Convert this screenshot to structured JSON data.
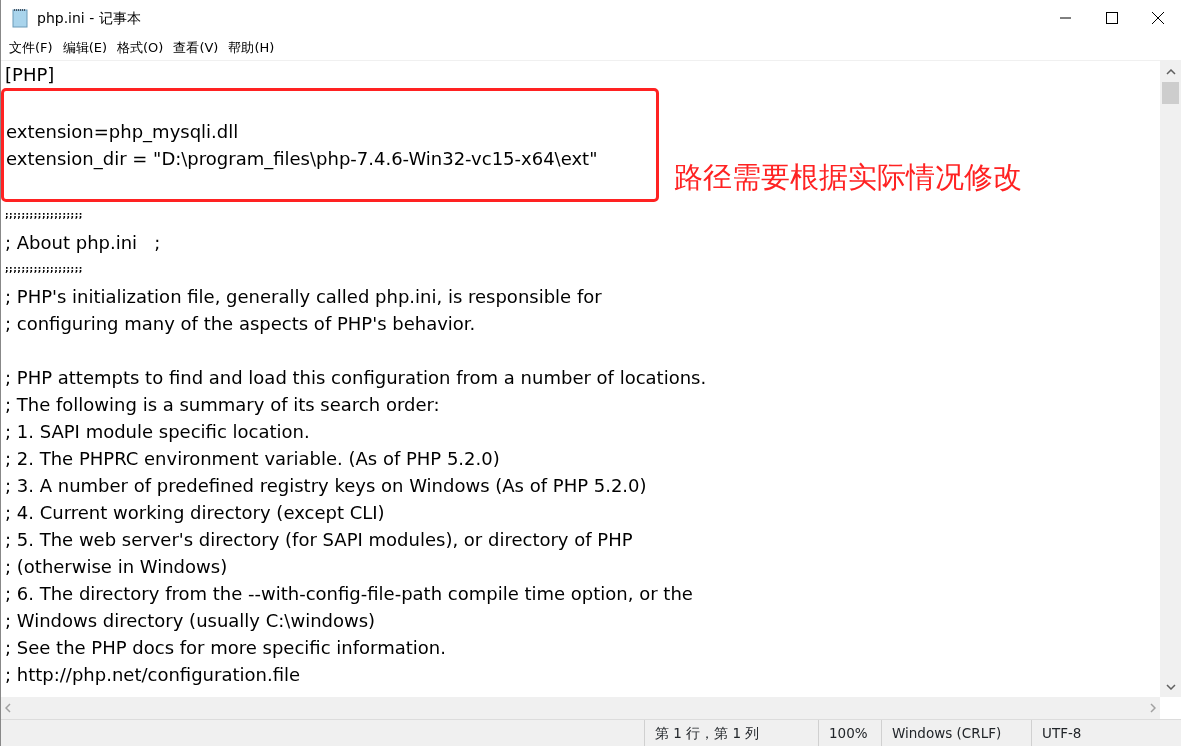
{
  "window": {
    "title": "php.ini - 记事本"
  },
  "menu": [
    "文件(F)",
    "编辑(E)",
    "格式(O)",
    "查看(V)",
    "帮助(H)"
  ],
  "editor": {
    "lines_top": [
      {
        "kind": "text",
        "text": "[PHP]"
      }
    ],
    "annotation_box": {
      "lines": [
        {
          "kind": "blank"
        },
        {
          "kind": "text",
          "text": "extension=php_mysqli.dll"
        },
        {
          "kind": "text",
          "text": "extension_dir = \"D:\\program_files\\php-7.4.6-Win32-vc15-x64\\ext\""
        },
        {
          "kind": "blank"
        }
      ],
      "note": "路径需要根据实际情况修改"
    },
    "lines": [
      {
        "kind": "separator",
        "text": ";;;;;;;;;;;;;;;;;;;"
      },
      {
        "kind": "text",
        "text": "; About php.ini   ;"
      },
      {
        "kind": "separator",
        "text": ";;;;;;;;;;;;;;;;;;;"
      },
      {
        "kind": "text",
        "text": "; PHP's initialization file, generally called php.ini, is responsible for"
      },
      {
        "kind": "text",
        "text": "; configuring many of the aspects of PHP's behavior."
      },
      {
        "kind": "blank"
      },
      {
        "kind": "text",
        "text": "; PHP attempts to find and load this configuration from a number of locations."
      },
      {
        "kind": "text",
        "text": "; The following is a summary of its search order:"
      },
      {
        "kind": "text",
        "text": "; 1. SAPI module specific location."
      },
      {
        "kind": "text",
        "text": "; 2. The PHPRC environment variable. (As of PHP 5.2.0)"
      },
      {
        "kind": "text",
        "text": "; 3. A number of predefined registry keys on Windows (As of PHP 5.2.0)"
      },
      {
        "kind": "text",
        "text": "; 4. Current working directory (except CLI)"
      },
      {
        "kind": "text",
        "text": "; 5. The web server's directory (for SAPI modules), or directory of PHP"
      },
      {
        "kind": "text",
        "text": "; (otherwise in Windows)"
      },
      {
        "kind": "text",
        "text": "; 6. The directory from the --with-config-file-path compile time option, or the"
      },
      {
        "kind": "text",
        "text": "; Windows directory (usually C:\\windows)"
      },
      {
        "kind": "text",
        "text": "; See the PHP docs for more specific information."
      },
      {
        "kind": "text",
        "text": "; http://php.net/configuration.file"
      }
    ]
  },
  "status_bar": [
    "第 1 行，第 1 列",
    "100%",
    "Windows (CRLF)",
    "UTF-8"
  ]
}
